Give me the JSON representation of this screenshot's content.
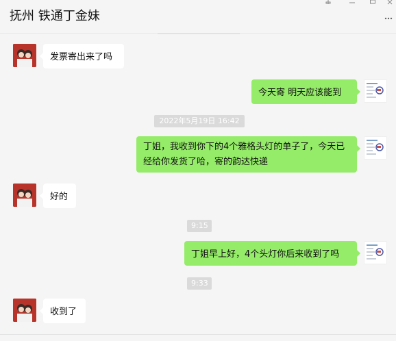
{
  "header": {
    "title": "抚州 铁通丁金妹"
  },
  "messages": [
    {
      "side": "in",
      "text": "发票寄出来了吗"
    },
    {
      "side": "out",
      "text": "今天寄  明天应该能到"
    },
    {
      "time": "2022年5月19日 16:42"
    },
    {
      "side": "out",
      "text": "丁姐，我收到你下的4个雅格头灯的单子了，今天已经给你发货了哈，寄的韵达快递"
    },
    {
      "side": "in",
      "text": "好的"
    },
    {
      "time": "9:15"
    },
    {
      "side": "out",
      "text": "丁姐早上好，4个头灯你后来收到了吗"
    },
    {
      "time": "9:33"
    },
    {
      "side": "in",
      "text": "收到了"
    }
  ],
  "colors": {
    "background": "#f5f5f5",
    "incoming_bubble": "#ffffff",
    "outgoing_bubble": "#95ec69",
    "timestamp_bg": "#dadada"
  },
  "icons": [
    "pin-icon",
    "minimize-icon",
    "maximize-icon",
    "close-icon",
    "more-icon"
  ]
}
